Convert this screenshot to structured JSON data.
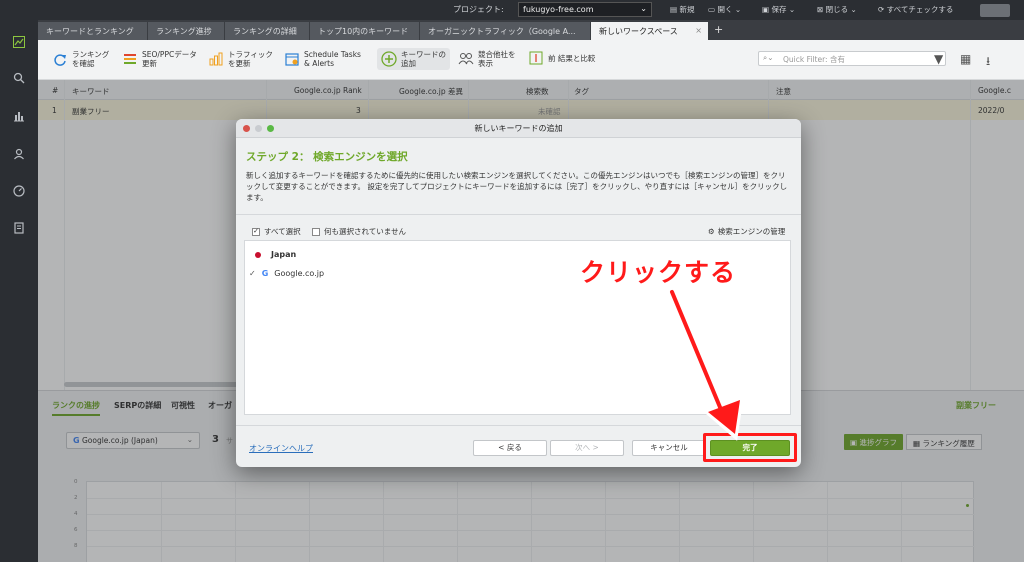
{
  "topbar": {
    "project_label": "プロジェクト:",
    "project_value": "fukugyo-free.com",
    "items": [
      "新規",
      "開く",
      "保存",
      "閉じる",
      "すべてチェックする"
    ]
  },
  "tabs": [
    "キーワードとランキング",
    "ランキング進捗",
    "ランキングの詳細",
    "トップ10内のキーワード",
    "オーガニックトラフィック（Google A...",
    "新しいワークスペース"
  ],
  "toolbar": {
    "tools": [
      "ランキング\nを確認",
      "SEO/PPCデータ\n更新",
      "トラフィック\nを更新",
      "Schedule Tasks\n& Alerts",
      "キーワードの\n追加",
      "競合他社を\n表示",
      "前 結果と比較"
    ],
    "quick_filter_placeholder": "Quick Filter: 含有"
  },
  "table": {
    "headers": [
      "#",
      "キーワード",
      "Google.co.jp Rank",
      "Google.co.jp 差異",
      "検索数",
      "タグ",
      "注意",
      "Google.c"
    ],
    "row": {
      "num": "1",
      "keyword": "副業フリー",
      "rank": "3",
      "search_volume": "未確認",
      "date": "2022/0"
    }
  },
  "lower": {
    "tabs": [
      "ランクの進捗",
      "SERPの詳細",
      "可視性",
      "オーガ"
    ],
    "right_title": "副業フリー",
    "se_select": "Google.co.jp (Japan)",
    "rank_value": "3",
    "sub_label": "サ",
    "btn_graph": "進捗グラフ",
    "btn_history": "ランキング履歴",
    "y_labels": [
      "0",
      "2",
      "4",
      "6",
      "8"
    ]
  },
  "dialog": {
    "title": "新しいキーワードの追加",
    "step": "ステップ 2： 検索エンジンを選択",
    "description": "新しく追加するキーワードを確認するために優先的に使用したい検索エンジンを選択してください。この優先エンジンはいつでも［検索エンジンの管理］をクリックして変更することができます。 設定を完了してプロジェクトにキーワードを追加するには［完了］をクリックし、やり直すには［キャンセル］をクリックします。",
    "select_all": "すべて選択",
    "select_none": "何も選択されていません",
    "manage": "検索エンジンの管理",
    "country": "Japan",
    "engine": "Google.co.jp",
    "help": "オンラインヘルプ",
    "back": "< 戻る",
    "next": "次へ >",
    "cancel": "キャンセル",
    "finish": "完了"
  },
  "annotation": "クリックする",
  "colors": {
    "accent": "#6fa82a",
    "annotation": "#ff1a1a"
  }
}
